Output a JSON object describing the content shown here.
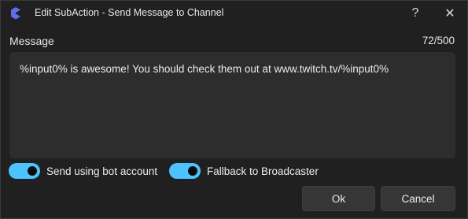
{
  "window": {
    "title": "Edit SubAction - Send Message to Channel",
    "help_glyph": "?",
    "close_glyph": "✕",
    "accent_color": "#4cc2ff"
  },
  "message": {
    "label": "Message",
    "count": "72/500",
    "value": "%input0% is awesome! You should check them out at www.twitch.tv/%input0%"
  },
  "toggles": [
    {
      "label": "Send using bot account",
      "on": true
    },
    {
      "label": "Fallback to Broadcaster",
      "on": true
    }
  ],
  "buttons": {
    "ok_label": "Ok",
    "cancel_label": "Cancel"
  }
}
